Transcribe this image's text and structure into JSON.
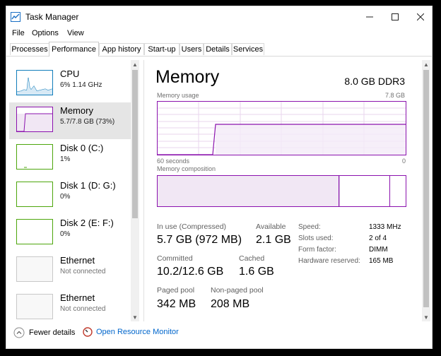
{
  "window": {
    "title": "Task Manager"
  },
  "menu": [
    "File",
    "Options",
    "View"
  ],
  "tabs": [
    "Processes",
    "Performance",
    "App history",
    "Start-up",
    "Users",
    "Details",
    "Services"
  ],
  "active_tab": "Performance",
  "sidebar": [
    {
      "name": "CPU",
      "detail": "6%  1.14 GHz",
      "color": "#117dbb"
    },
    {
      "name": "Memory",
      "detail": "5.7/7.8 GB (73%)",
      "color": "#8b12ae"
    },
    {
      "name": "Disk 0 (C:)",
      "detail": "1%",
      "color": "#4da60c"
    },
    {
      "name": "Disk 1 (D: G:)",
      "detail": "0%",
      "color": "#4da60c"
    },
    {
      "name": "Disk 2 (E: F:)",
      "detail": "0%",
      "color": "#4da60c"
    },
    {
      "name": "Ethernet",
      "detail": "Not connected",
      "color": "#a7a7a7"
    },
    {
      "name": "Ethernet",
      "detail": "Not connected",
      "color": "#a7a7a7"
    }
  ],
  "main": {
    "title": "Memory",
    "spec": "8.0 GB DDR3",
    "usage_label": "Memory usage",
    "usage_max": "7.8 GB",
    "time_left": "60 seconds",
    "time_right": "0",
    "composition_label": "Memory composition",
    "usage_fraction": 0.73
  },
  "stats": {
    "in_use_label": "In use (Compressed)",
    "in_use_value": "5.7 GB (972 MB)",
    "available_label": "Available",
    "available_value": "2.1 GB",
    "committed_label": "Committed",
    "committed_value": "10.2/12.6 GB",
    "cached_label": "Cached",
    "cached_value": "1.6 GB",
    "paged_label": "Paged pool",
    "paged_value": "342 MB",
    "nonpaged_label": "Non-paged pool",
    "nonpaged_value": "208 MB"
  },
  "specs": [
    {
      "label": "Speed:",
      "value": "1333 MHz"
    },
    {
      "label": "Slots used:",
      "value": "2 of 4"
    },
    {
      "label": "Form factor:",
      "value": "DIMM"
    },
    {
      "label": "Hardware reserved:",
      "value": "165 MB"
    }
  ],
  "footer": {
    "fewer_details": "Fewer details",
    "resource_monitor": "Open Resource Monitor"
  },
  "colors": {
    "memory": "#8b12ae",
    "cpu": "#117dbb",
    "disk": "#4da60c",
    "link": "#0066cc"
  }
}
